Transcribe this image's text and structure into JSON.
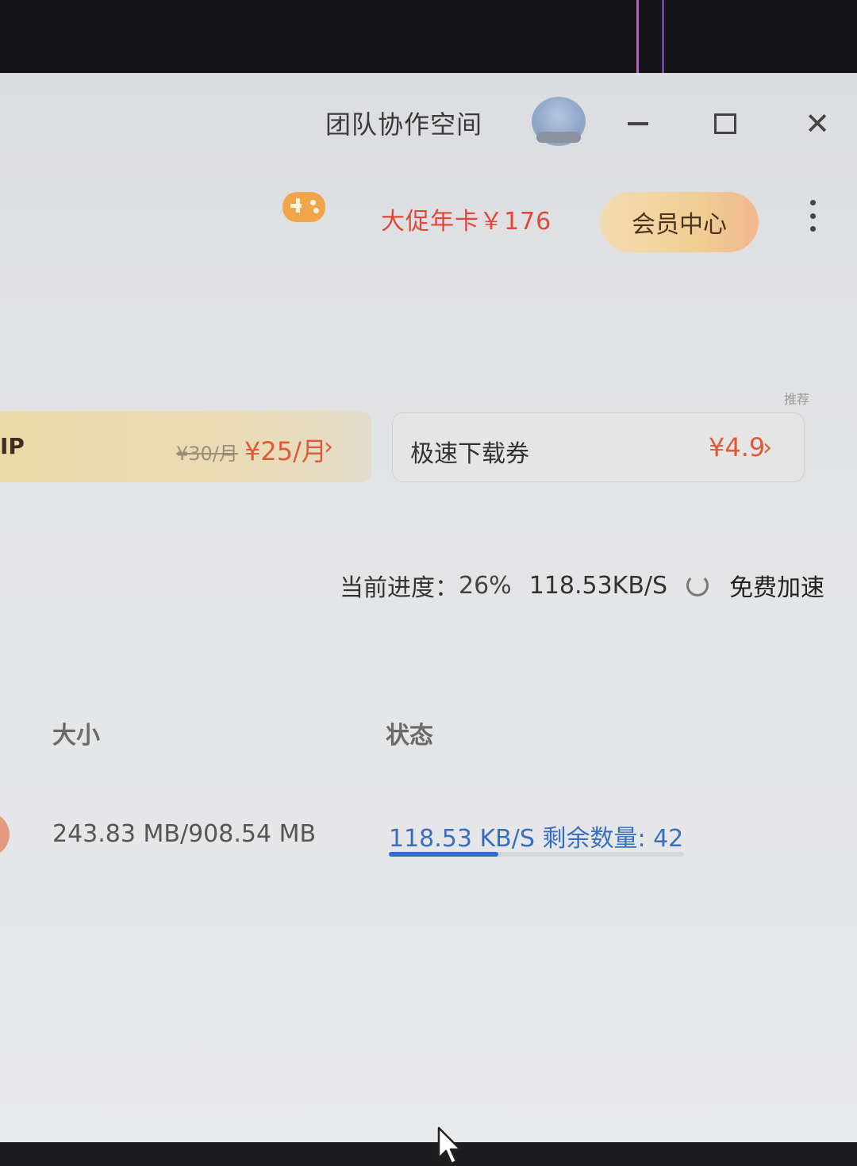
{
  "window": {
    "title": "团队协作空间"
  },
  "header": {
    "promo_text": "大促年卡￥176",
    "member_center_label": "会员中心"
  },
  "offers": {
    "recommend_tag": "推荐",
    "vip": {
      "label": "IP",
      "old_price": "¥30/月",
      "new_price": "¥25/月",
      "chevron": "›"
    },
    "speed_coupon": {
      "label": "极速下载券",
      "price": "¥4.9",
      "chevron": "›"
    }
  },
  "progress": {
    "label": "当前进度：",
    "percent": "26%",
    "speed": "118.53KB/S",
    "boost_label": "免费加速"
  },
  "table": {
    "columns": [
      "大小",
      "状态"
    ],
    "rows": [
      {
        "size": "243.83 MB/908.54 MB",
        "status": "118.53 KB/S 剩余数量: 42",
        "progress_fraction": 0.37
      }
    ]
  },
  "colors": {
    "accent_blue": "#2c6fd6",
    "promo_red": "#e0483a",
    "member_gold": "#f1cf94"
  }
}
